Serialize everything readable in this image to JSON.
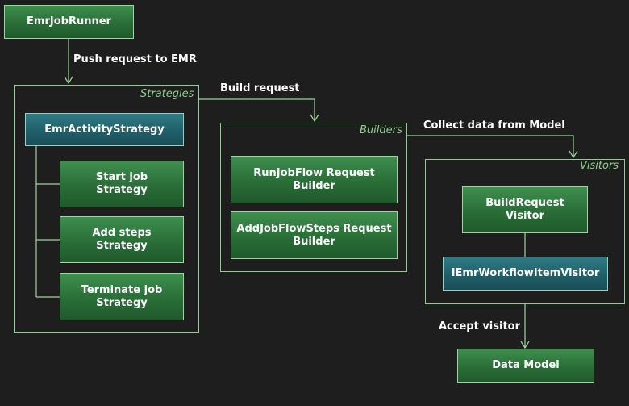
{
  "nodes": {
    "emr_job_runner": "EmrJobRunner",
    "emr_activity_strategy": "EmrActivityStrategy",
    "start_job_strategy": "Start job\nStrategy",
    "add_steps_strategy": "Add steps\nStrategy",
    "terminate_job_strategy": "Terminate job\nStrategy",
    "run_job_flow_builder": "RunJobFlow Request\nBuilder",
    "add_job_flow_steps_builder": "AddJobFlowSteps Request\nBuilder",
    "build_request_visitor": "BuildRequest\nVisitor",
    "iemr_workflow_item_visitor": "IEmrWorkflowItemVisitor",
    "data_model": "Data Model"
  },
  "groups": {
    "strategies": "Strategies",
    "builders": "Builders",
    "visitors": "Visitors"
  },
  "edges": {
    "push_request": "Push request to EMR",
    "build_request": "Build request",
    "collect_data": "Collect data from Model",
    "accept_visitor": "Accept visitor"
  },
  "colors": {
    "node_green": "#2a6d38",
    "node_teal": "#215f69",
    "border": "#9fd39f",
    "background": "#1e1e1e"
  }
}
